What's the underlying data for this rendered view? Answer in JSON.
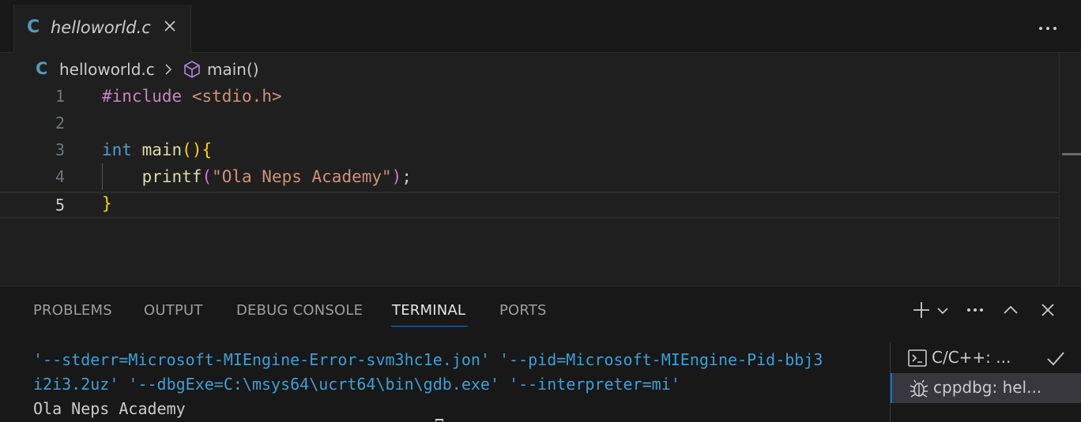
{
  "editor_tab": {
    "filename": "helloworld.c",
    "file_type_icon": "C",
    "close_icon": "close-icon"
  },
  "toolbar": {
    "more_icon": "more-actions-icon"
  },
  "breadcrumb": {
    "file_icon": "C",
    "file": "helloworld.c",
    "symbol_icon": "symbol-method-icon",
    "symbol": "main()"
  },
  "code": {
    "lines": [
      {
        "number": "1",
        "text": "#include <stdio.h>"
      },
      {
        "number": "2",
        "text": ""
      },
      {
        "number": "3",
        "text": "int main(){"
      },
      {
        "number": "4",
        "text": "    printf(\"Ola Neps Academy\");"
      },
      {
        "number": "5",
        "text": "}"
      }
    ],
    "current_line": 5
  },
  "panel": {
    "tabs": [
      "PROBLEMS",
      "OUTPUT",
      "DEBUG CONSOLE",
      "TERMINAL",
      "PORTS"
    ],
    "active_tab": "TERMINAL",
    "actions": [
      "add-terminal-icon",
      "chevron-down-icon",
      "more-actions-icon",
      "maximize-panel-icon",
      "close-icon"
    ]
  },
  "terminal": {
    "lines": [
      "'--stderr=Microsoft-MIEngine-Error-svm3hc1e.jon' '--pid=Microsoft-MIEngine-Pid-bbj3",
      "i2i3.2uz' '--dbgExe=C:\\msys64\\ucrt64\\bin\\gdb.exe' '--interpreter=mi'",
      "Ola Neps Academy"
    ],
    "instances": [
      {
        "label": "C/C++: ...",
        "icon": "terminal-icon",
        "status_icon": "check-icon"
      },
      {
        "label": "cppdbg: hel...",
        "icon": "debug-icon",
        "selected": true
      }
    ]
  },
  "colors": {
    "background": "#1f1f1f",
    "panel": "#181818",
    "accent": "#0078d4",
    "c_file": "#519aba",
    "preprocessor": "#c586c0",
    "string": "#ce9178",
    "keyword": "#569cd6",
    "function": "#dcdcaa",
    "terminal_text": "#3b9fd8"
  }
}
